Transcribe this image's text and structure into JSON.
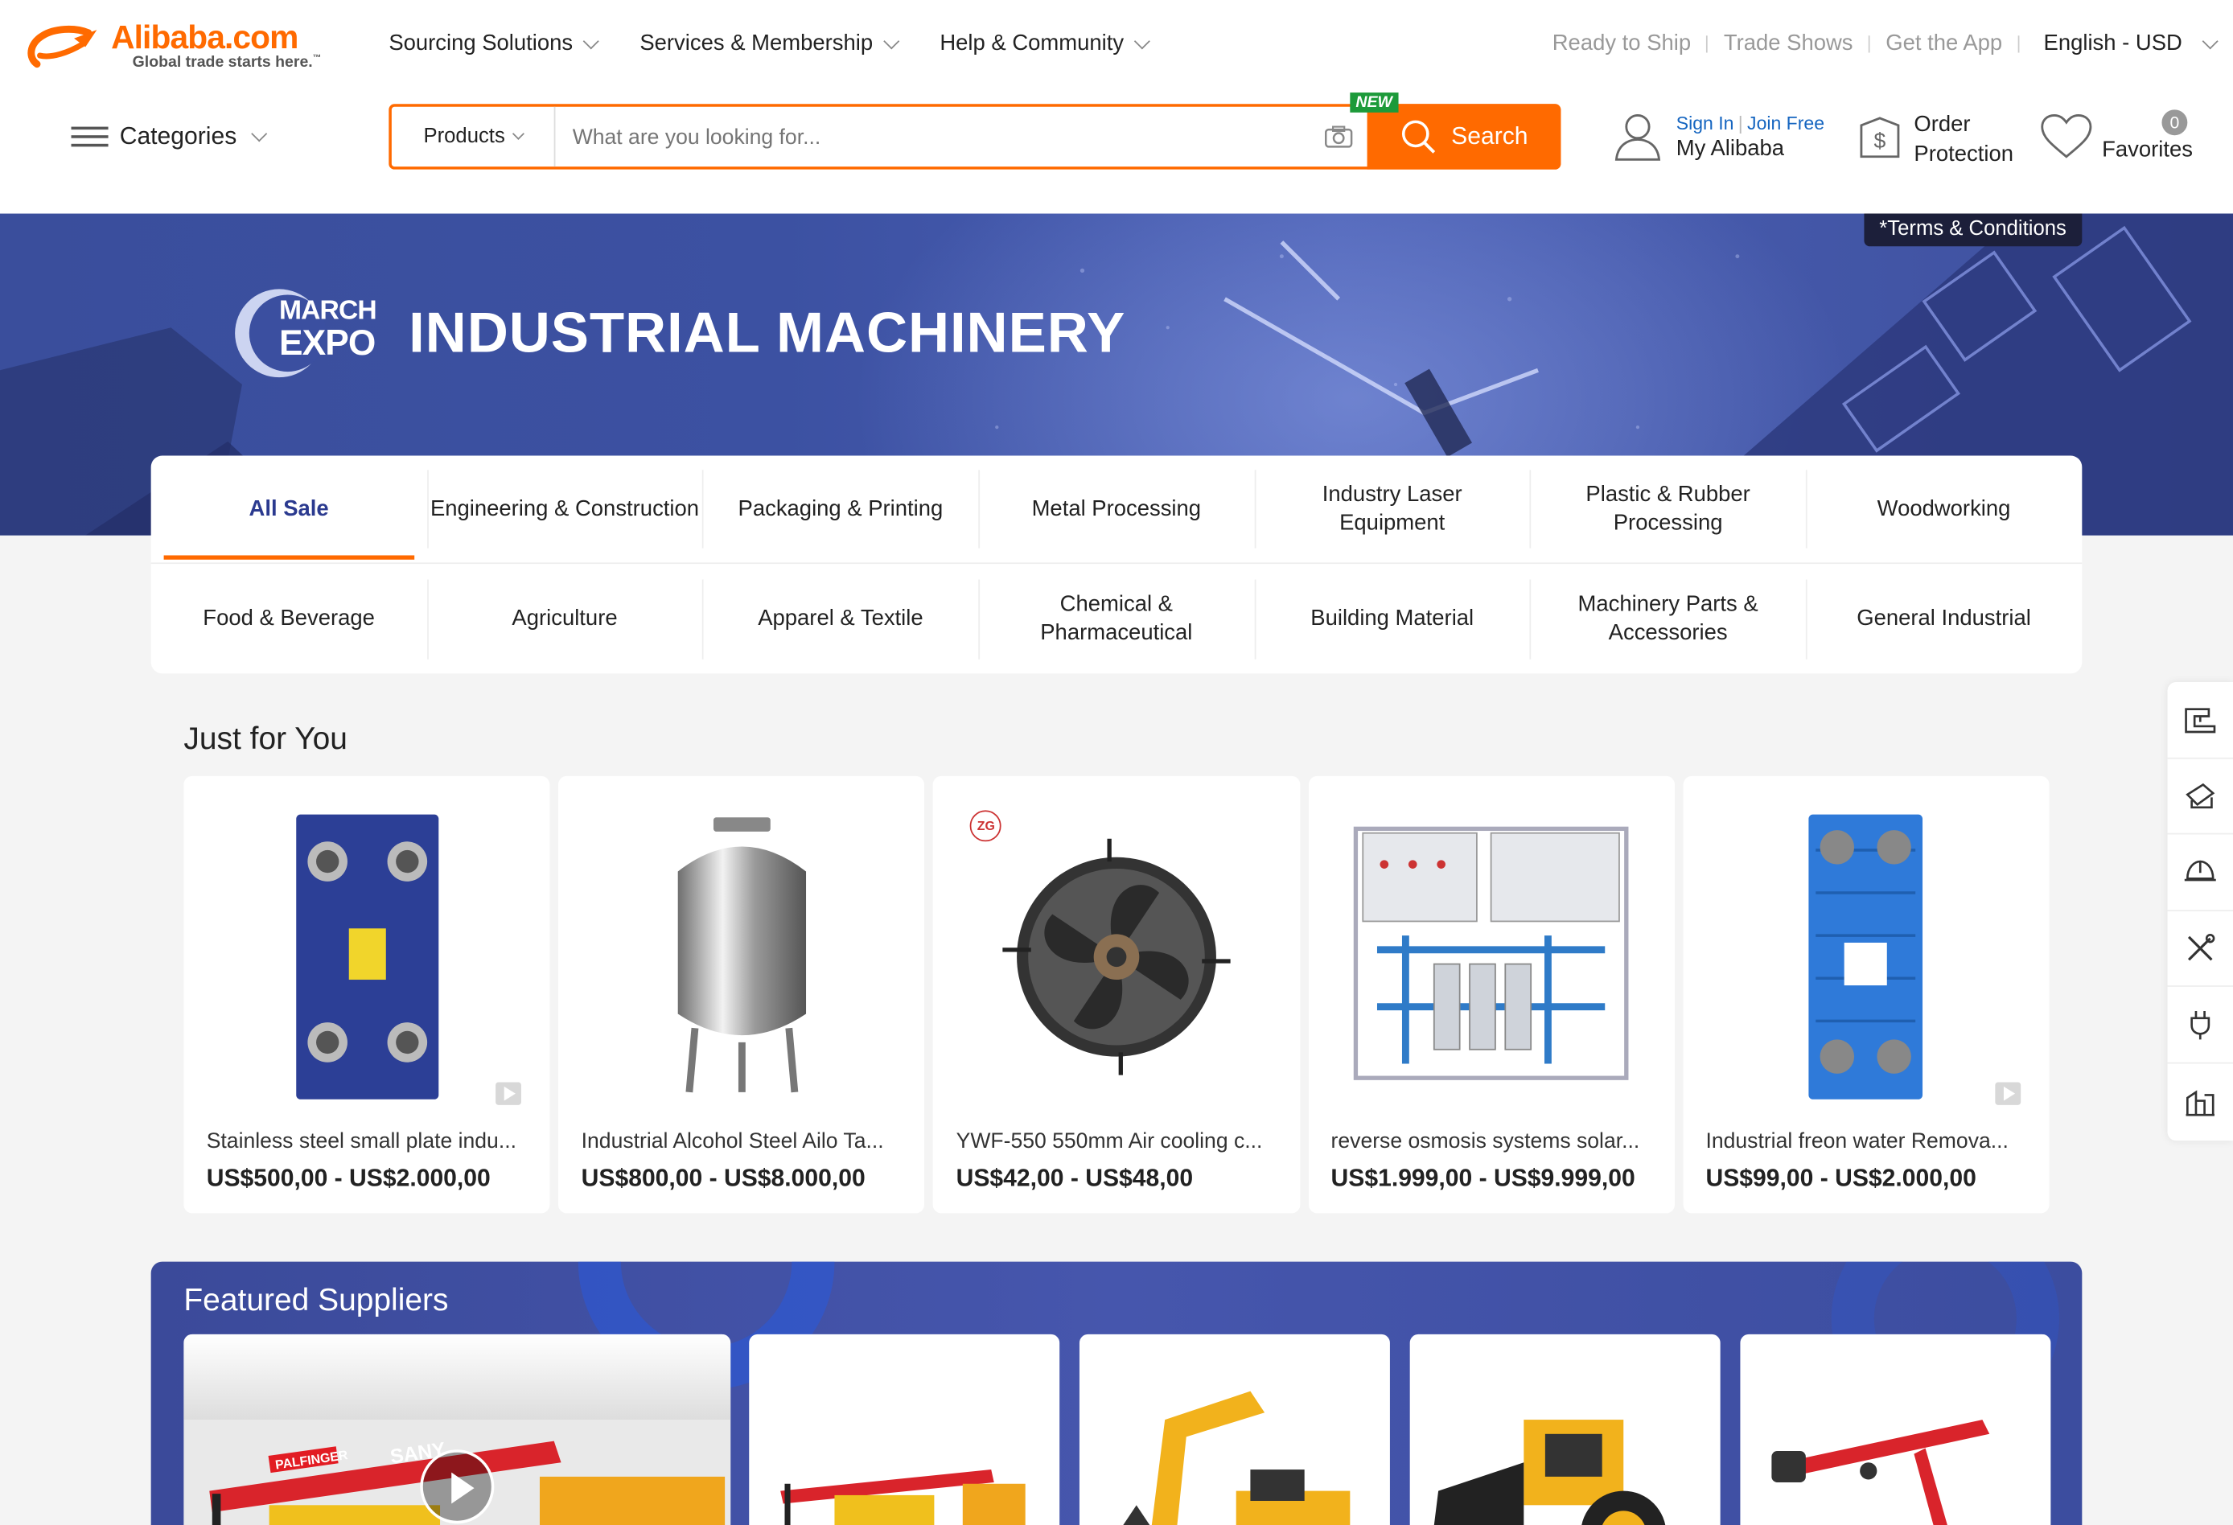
{
  "brand": {
    "name": "Alibaba.com",
    "tagline": "Global trade starts here.",
    "tagline_mark": "™"
  },
  "topnav": {
    "items": [
      {
        "label": "Sourcing Solutions"
      },
      {
        "label": "Services & Membership"
      },
      {
        "label": "Help & Community"
      }
    ]
  },
  "toplinks": {
    "ready_to_ship": "Ready to Ship",
    "trade_shows": "Trade Shows",
    "get_app": "Get the App",
    "language": "English - USD"
  },
  "categories_label": "Categories",
  "search": {
    "category": "Products",
    "placeholder": "What are you looking for...",
    "button": "Search",
    "new_badge": "NEW"
  },
  "account": {
    "sign_in": "Sign In",
    "join": "Join Free",
    "my_alibaba": "My Alibaba",
    "order_line1": "Order",
    "order_line2": "Protection",
    "favorites": "Favorites",
    "favorites_count": "0"
  },
  "banner": {
    "terms": "*Terms & Conditions",
    "expo_line1": "MARCH",
    "expo_line2": "EXPO",
    "title": "INDUSTRIAL MACHINERY"
  },
  "category_tabs": {
    "row1": [
      {
        "label": "All Sale",
        "active": true
      },
      {
        "label": "Engineering & Construction"
      },
      {
        "label": "Packaging & Printing"
      },
      {
        "label": "Metal Processing"
      },
      {
        "label": "Industry Laser Equipment"
      },
      {
        "label": "Plastic & Rubber Processing"
      },
      {
        "label": "Woodworking"
      }
    ],
    "row2": [
      {
        "label": "Food & Beverage"
      },
      {
        "label": "Agriculture"
      },
      {
        "label": "Apparel & Textile"
      },
      {
        "label": "Chemical & Pharmaceutical"
      },
      {
        "label": "Building Material"
      },
      {
        "label": "Machinery Parts & Accessories"
      },
      {
        "label": "General Industrial"
      }
    ]
  },
  "just_for_you": {
    "title": "Just for You",
    "products": [
      {
        "name": "Stainless steel small plate indu...",
        "price": "US$500,00 - US$2.000,00",
        "image": "plate-heat-exchanger-icon",
        "video": true
      },
      {
        "name": "Industrial Alcohol Steel Ailo Ta...",
        "price": "US$800,00 - US$8.000,00",
        "image": "steel-tank-icon"
      },
      {
        "name": "YWF-550 550mm Air cooling c...",
        "price": "US$42,00 - US$48,00",
        "image": "axial-fan-icon",
        "badge": "ZG"
      },
      {
        "name": "reverse osmosis systems solar...",
        "price": "US$1.999,00 - US$9.999,00",
        "image": "ro-system-icon"
      },
      {
        "name": "Industrial freon water Remova...",
        "price": "US$99,00 - US$2.000,00",
        "image": "blue-heat-exchanger-icon",
        "video": true
      }
    ]
  },
  "featured_suppliers": {
    "title": "Featured Suppliers",
    "crane_brand_1": "PALFINGER",
    "crane_brand_2": "SANY"
  },
  "side_tools": [
    "sewing-machine-icon",
    "printer-icon",
    "hard-hat-icon",
    "tools-icon",
    "plug-icon",
    "factory-icon"
  ],
  "colors": {
    "accent": "#ff6a00",
    "banner": "#3c51a2",
    "active_tab": "#2b3a8f",
    "link": "#1565c0"
  }
}
